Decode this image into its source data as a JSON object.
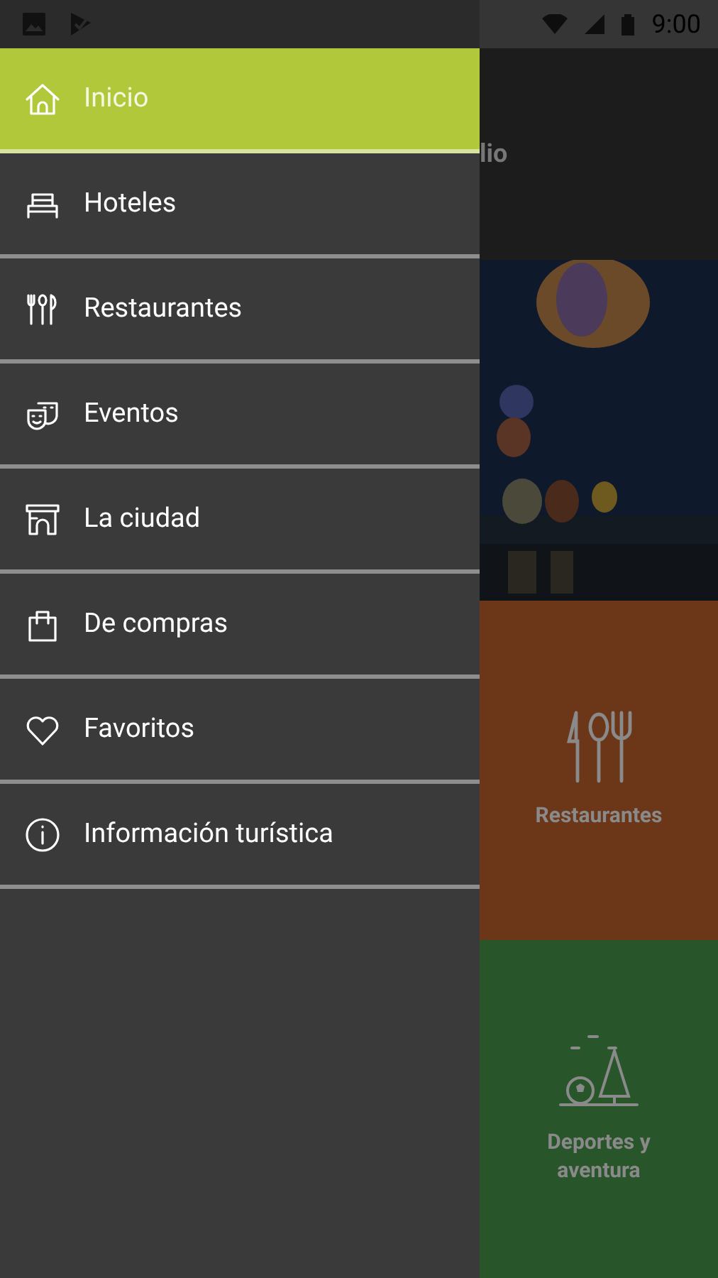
{
  "status_bar": {
    "time": "9:00"
  },
  "drawer": {
    "items": [
      {
        "label": "Inicio",
        "selected": true
      },
      {
        "label": "Hoteles",
        "selected": false
      },
      {
        "label": "Restaurantes",
        "selected": false
      },
      {
        "label": "Eventos",
        "selected": false
      },
      {
        "label": "La ciudad",
        "selected": false
      },
      {
        "label": "De compras",
        "selected": false
      },
      {
        "label": "Favoritos",
        "selected": false
      },
      {
        "label": "Información turística",
        "selected": false
      }
    ]
  },
  "background": {
    "app_bar_title": "lio",
    "tiles": [
      {
        "kind": "picture"
      },
      {
        "kind": "category",
        "label": "Restaurantes",
        "color": "#6c3618"
      },
      {
        "kind": "category",
        "label": "Deportes y aventura",
        "color": "#28552a"
      }
    ]
  }
}
